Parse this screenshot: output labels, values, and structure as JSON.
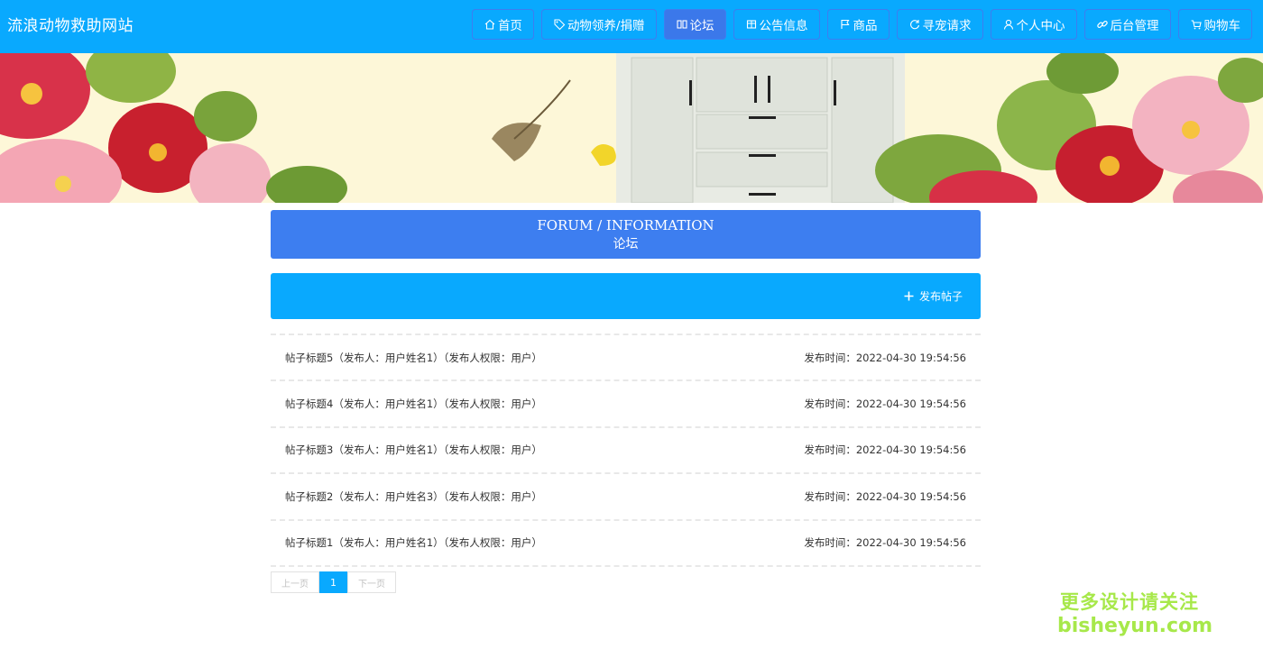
{
  "site": {
    "title": "流浪动物救助网站"
  },
  "nav": {
    "items": [
      {
        "label": "首页",
        "icon": "home-icon"
      },
      {
        "label": "动物领养/捐赠",
        "icon": "tag-icon"
      },
      {
        "label": "论坛",
        "icon": "forum-icon",
        "active": true
      },
      {
        "label": "公告信息",
        "icon": "notice-icon"
      },
      {
        "label": "商品",
        "icon": "flag-icon"
      },
      {
        "label": "寻宠请求",
        "icon": "refresh-icon"
      },
      {
        "label": "个人中心",
        "icon": "user-icon"
      },
      {
        "label": "后台管理",
        "icon": "link-icon"
      },
      {
        "label": "购物车",
        "icon": "cart-icon"
      }
    ]
  },
  "carousel": {
    "slide_count": 3,
    "active_index": 0
  },
  "section": {
    "title_en": "FORUM / INFORMATION",
    "title_cn": "论坛"
  },
  "toolbar": {
    "post_button_label": "发布帖子",
    "post_button_icon": "plus-icon"
  },
  "posts": [
    {
      "title": "帖子标题5（发布人：用户姓名1）（发布人权限：用户）",
      "time": "发布时间：2022-04-30 19:54:56"
    },
    {
      "title": "帖子标题4（发布人：用户姓名1）（发布人权限：用户）",
      "time": "发布时间：2022-04-30 19:54:56"
    },
    {
      "title": "帖子标题3（发布人：用户姓名1）（发布人权限：用户）",
      "time": "发布时间：2022-04-30 19:54:56"
    },
    {
      "title": "帖子标题2（发布人：用户姓名3）（发布人权限：用户）",
      "time": "发布时间：2022-04-30 19:54:56"
    },
    {
      "title": "帖子标题1（发布人：用户姓名1）（发布人权限：用户）",
      "time": "发布时间：2022-04-30 19:54:56"
    }
  ],
  "pagination": {
    "prev_label": "上一页",
    "current_page": "1",
    "next_label": "下一页"
  },
  "watermark": {
    "line1": "更多设计请关注",
    "line2": "bisheyun.com"
  },
  "colors": {
    "primary": "#09a9fe",
    "accent": "#3d7ef0",
    "watermark": "#a7e84a"
  }
}
